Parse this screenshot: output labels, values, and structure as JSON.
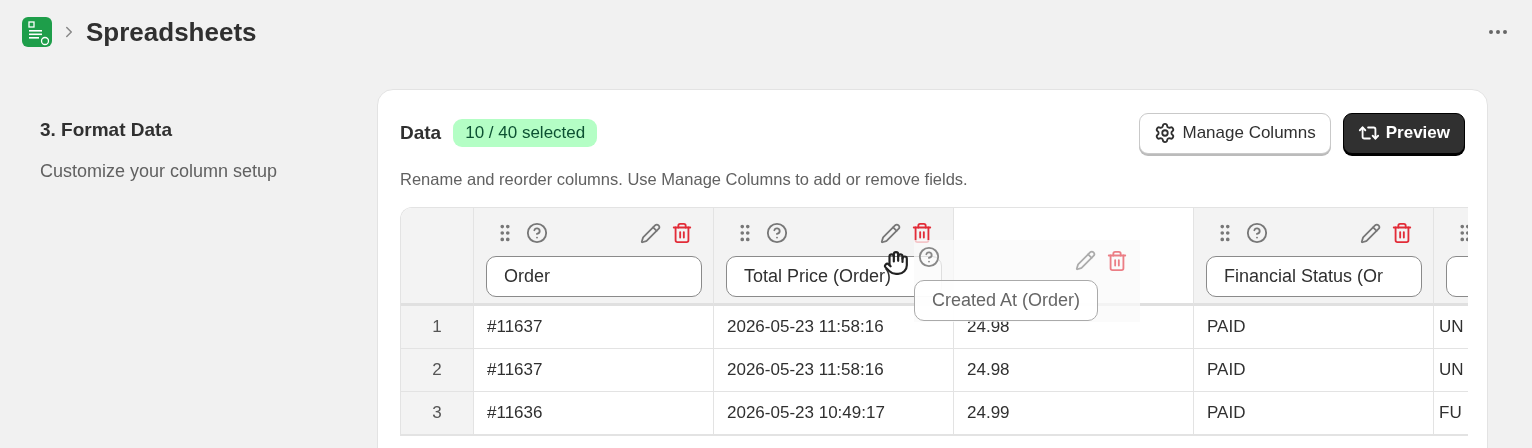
{
  "breadcrumb": {
    "title": "Spreadsheets"
  },
  "step": {
    "title": "3. Format Data",
    "subtitle": "Customize your column setup"
  },
  "card": {
    "title": "Data",
    "badge": "10 / 40 selected",
    "hint": "Rename and reorder columns. Use Manage Columns to add or remove fields.",
    "buttons": [
      {
        "label": "Manage Columns",
        "kind": "secondary"
      },
      {
        "label": "Preview",
        "kind": "primary"
      }
    ]
  },
  "table": {
    "columns": [
      {
        "kind": "field",
        "name": "Order"
      },
      {
        "kind": "field",
        "name": "Total Price (Order)"
      },
      {
        "kind": "placeholder"
      },
      {
        "kind": "field",
        "name": "Financial Status (Or"
      },
      {
        "kind": "field"
      }
    ],
    "rows": [
      {
        "index": "1",
        "cells": [
          "#11637",
          "2026-05-23 11:58:16",
          "24.98",
          "PAID",
          "UN"
        ]
      },
      {
        "index": "2",
        "cells": [
          "#11637",
          "2026-05-23 11:58:16",
          "24.98",
          "PAID",
          "UN"
        ]
      },
      {
        "index": "3",
        "cells": [
          "#11636",
          "2026-05-23 10:49:17",
          "24.99",
          "PAID",
          "FU"
        ]
      }
    ]
  },
  "drag_ghost": {
    "label": "Created At (Order)"
  }
}
